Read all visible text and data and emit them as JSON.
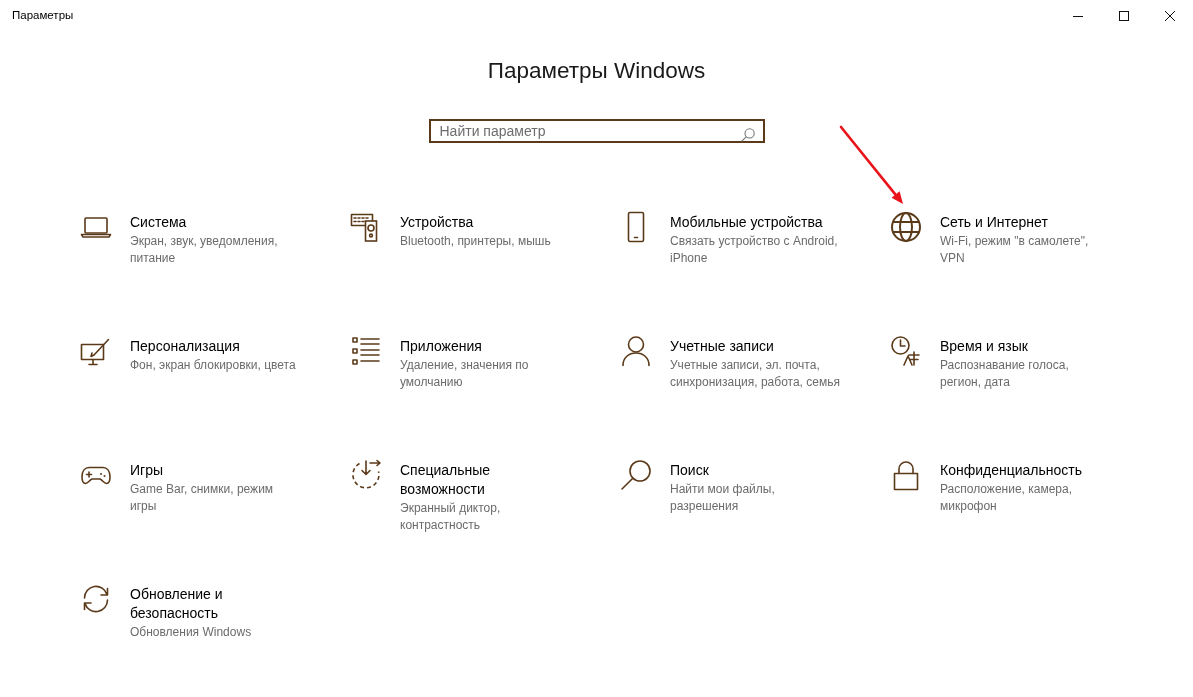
{
  "window": {
    "title": "Параметры"
  },
  "heading": "Параметры Windows",
  "search": {
    "placeholder": "Найти параметр"
  },
  "categories": [
    {
      "kind": "system",
      "title": "Система",
      "description": "Экран, звук, уведомления, питание",
      "annotated": false
    },
    {
      "kind": "devices",
      "title": "Устройства",
      "description": "Bluetooth, принтеры, мышь",
      "annotated": false
    },
    {
      "kind": "phone",
      "title": "Мобильные устройства",
      "description": "Связать устройство с Android, iPhone",
      "annotated": false
    },
    {
      "kind": "network",
      "title": "Сеть и Интернет",
      "description": "Wi-Fi, режим \"в самолете\", VPN",
      "annotated": true
    },
    {
      "kind": "personalization",
      "title": "Персонализация",
      "description": "Фон, экран блокировки, цвета",
      "annotated": false
    },
    {
      "kind": "apps",
      "title": "Приложения",
      "description": "Удаление, значения по умолчанию",
      "annotated": false
    },
    {
      "kind": "accounts",
      "title": "Учетные записи",
      "description": "Учетные записи, эл. почта, синхронизация, работа, семья",
      "annotated": false
    },
    {
      "kind": "time",
      "title": "Время и язык",
      "description": "Распознавание голоса, регион, дата",
      "annotated": false
    },
    {
      "kind": "gaming",
      "title": "Игры",
      "description": "Game Bar, снимки, режим игры",
      "annotated": false
    },
    {
      "kind": "accessibility",
      "title": "Специальные возможности",
      "description": "Экранный диктор, контрастность",
      "annotated": false
    },
    {
      "kind": "search",
      "title": "Поиск",
      "description": "Найти мои файлы, разрешения",
      "annotated": false
    },
    {
      "kind": "privacy",
      "title": "Конфиденциальность",
      "description": "Расположение, камера, микрофон",
      "annotated": false
    },
    {
      "kind": "update",
      "title": "Обновление и безопасность",
      "description": "Обновления Windows",
      "annotated": false
    }
  ]
}
